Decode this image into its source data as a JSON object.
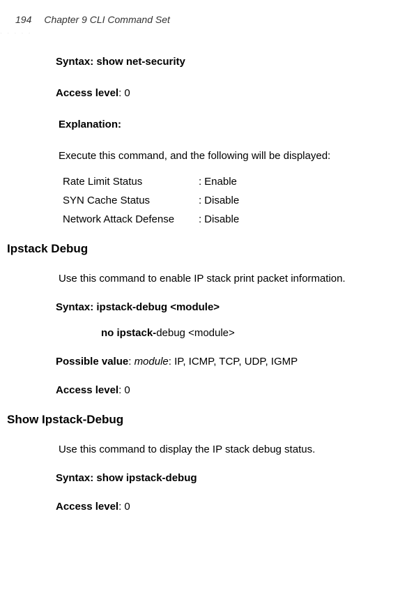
{
  "header": {
    "page_number": "194",
    "chapter_title": "Chapter 9 CLI Command Set"
  },
  "section1": {
    "syntax_label": "Syntax:",
    "syntax_value": "show net-security",
    "access_label": "Access level",
    "access_value": ": 0",
    "explanation_label": "Explanation:",
    "explanation_text": "Execute this command, and the following will be displayed:",
    "rows": [
      {
        "label": "Rate Limit Status",
        "value": "Enable"
      },
      {
        "label": "SYN Cache Status",
        "value": "Disable"
      },
      {
        "label": "Network Attack Defense",
        "value": "Disable"
      }
    ]
  },
  "section2": {
    "heading": "Ipstack Debug",
    "desc": "Use this command to enable IP stack print packet information.",
    "syntax_label": "Syntax:",
    "syntax_value": "ipstack-debug <module>",
    "syntax2_bold": "no ipstack-",
    "syntax2_rest": "debug <module>",
    "possible_label": "Possible value",
    "possible_sep": ": ",
    "possible_italic": "module",
    "possible_rest": ": IP, ICMP, TCP, UDP, IGMP",
    "access_label": "Access level",
    "access_value": ": 0"
  },
  "section3": {
    "heading": "Show Ipstack-Debug",
    "desc": "Use this command to display the IP stack debug status.",
    "syntax_label": "Syntax:",
    "syntax_value": "show ipstack-debug",
    "access_label": "Access level",
    "access_value": ": 0"
  }
}
